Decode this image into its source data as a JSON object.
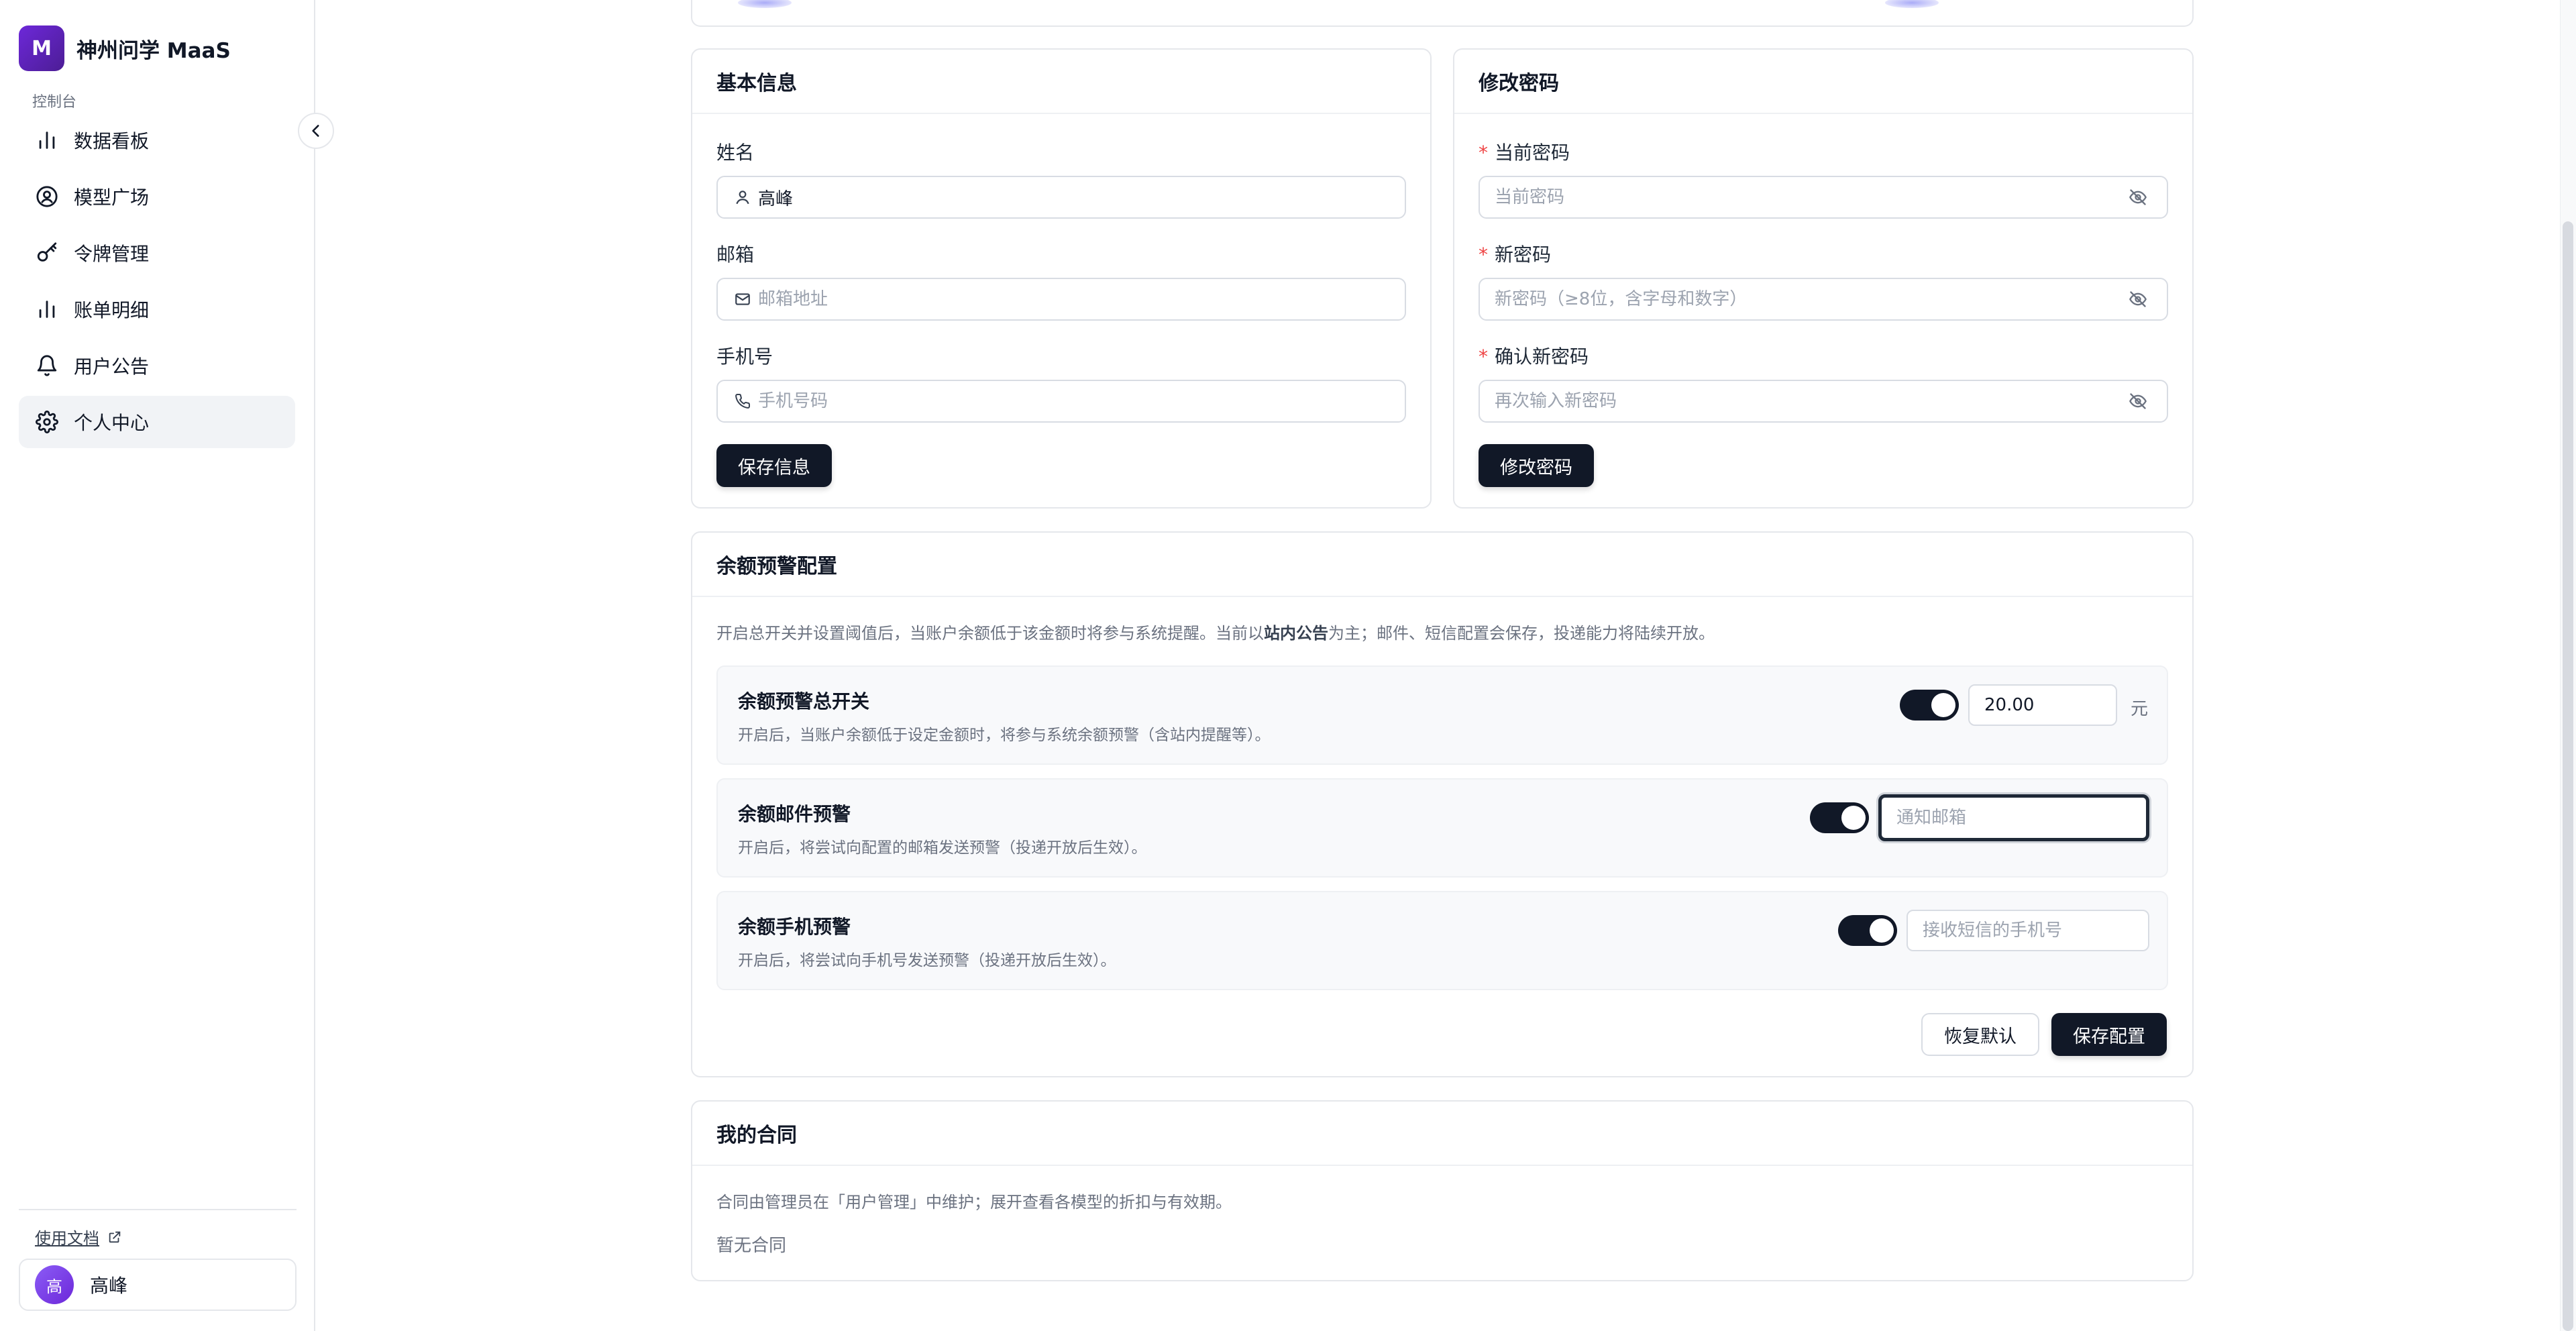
{
  "brand": {
    "logo_letter": "M",
    "name": "神州问学 MaaS"
  },
  "sidebar": {
    "section_label": "控制台",
    "items": [
      {
        "label": "数据看板",
        "icon": "bar-chart-icon",
        "active": false
      },
      {
        "label": "模型广场",
        "icon": "user-circle-icon",
        "active": false
      },
      {
        "label": "令牌管理",
        "icon": "key-icon",
        "active": false
      },
      {
        "label": "账单明细",
        "icon": "bar-chart-icon",
        "active": false
      },
      {
        "label": "用户公告",
        "icon": "bell-icon",
        "active": false
      },
      {
        "label": "个人中心",
        "icon": "gear-icon",
        "active": true
      }
    ],
    "docs_label": "使用文档",
    "user": {
      "avatar_text": "高",
      "name": "高峰"
    }
  },
  "basic_info": {
    "title": "基本信息",
    "name_label": "姓名",
    "name_value": "高峰",
    "email_label": "邮箱",
    "email_placeholder": "邮箱地址",
    "phone_label": "手机号",
    "phone_placeholder": "手机号码",
    "save_label": "保存信息"
  },
  "password": {
    "title": "修改密码",
    "current_label": "当前密码",
    "current_placeholder": "当前密码",
    "new_label": "新密码",
    "new_placeholder": "新密码（≥8位，含字母和数字）",
    "confirm_label": "确认新密码",
    "confirm_placeholder": "再次输入新密码",
    "submit_label": "修改密码",
    "required_mark": "*"
  },
  "balance_alert": {
    "title": "余额预警配置",
    "desc_prefix": "开启总开关并设置阈值后，当账户余额低于该金额时将参与系统提醒。当前以",
    "desc_bold": "站内公告",
    "desc_suffix": "为主；邮件、短信配置会保存，投递能力将陆续开放。",
    "master": {
      "title": "余额预警总开关",
      "desc": "开启后，当账户余额低于设定金额时，将参与系统余额预警（含站内提醒等）。",
      "enabled": true,
      "threshold": "20.00",
      "unit": "元"
    },
    "email": {
      "title": "余额邮件预警",
      "desc": "开启后，将尝试向配置的邮箱发送预警（投递开放后生效）。",
      "enabled": true,
      "placeholder": "通知邮箱"
    },
    "sms": {
      "title": "余额手机预警",
      "desc": "开启后，将尝试向手机号发送预警（投递开放后生效）。",
      "enabled": true,
      "placeholder": "接收短信的手机号"
    },
    "reset_label": "恢复默认",
    "save_label": "保存配置"
  },
  "contracts": {
    "title": "我的合同",
    "desc": "合同由管理员在「用户管理」中维护；展开查看各模型的折扣与有效期。",
    "empty": "暂无合同"
  },
  "colors": {
    "primary": "#111827",
    "brand": "#5b21b6",
    "border": "#e5e7eb",
    "required": "#ef4444"
  }
}
